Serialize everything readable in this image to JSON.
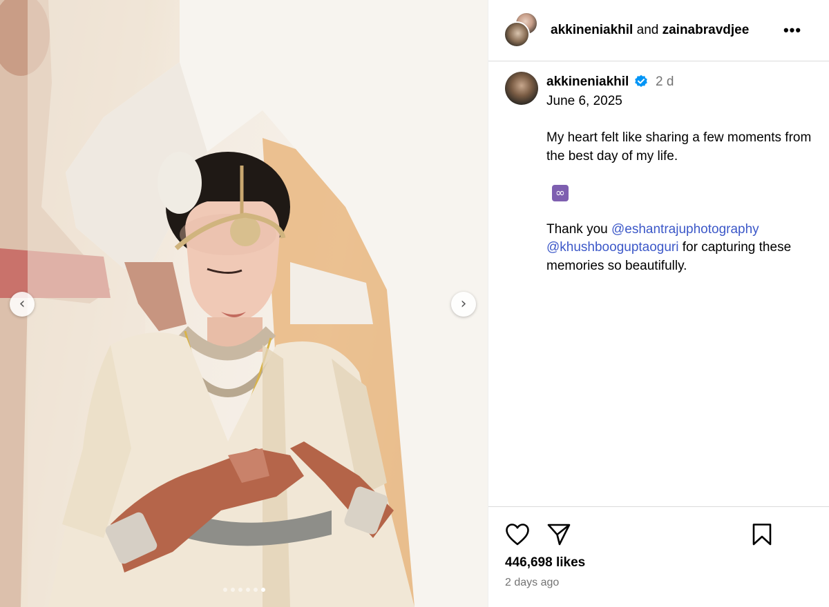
{
  "header": {
    "user1": "akkineniakhil",
    "joiner": " and ",
    "user2": "zainabravdjee",
    "more_icon": "more-horizontal-icon",
    "more_label": "•••"
  },
  "media": {
    "prev_icon": "chevron-left-icon",
    "next_icon": "chevron-right-icon",
    "prev_glyph": "‹",
    "next_glyph": "›",
    "slide_count": 6,
    "active_slide": 6
  },
  "caption": {
    "username": "akkineniakhil",
    "verified": true,
    "time": "2 d",
    "date": "June 6, 2025",
    "line1": "My heart felt like sharing a few moments from the best day of my life.",
    "emoji": "∞",
    "thanks_prefix": "Thank you ",
    "mention1": "@eshantrajuphotography",
    "mention2": "@khushbooguptaoguri",
    "thanks_suffix": " for capturing these memories so beautifully."
  },
  "actions": {
    "like_icon": "heart-icon",
    "share_icon": "send-icon",
    "save_icon": "bookmark-icon",
    "likes": "446,698 likes",
    "ago": "2 days ago"
  },
  "colors": {
    "link": "#3c58c8",
    "muted": "#737373",
    "verified": "#0095f6",
    "divider": "#dbdbdb"
  }
}
